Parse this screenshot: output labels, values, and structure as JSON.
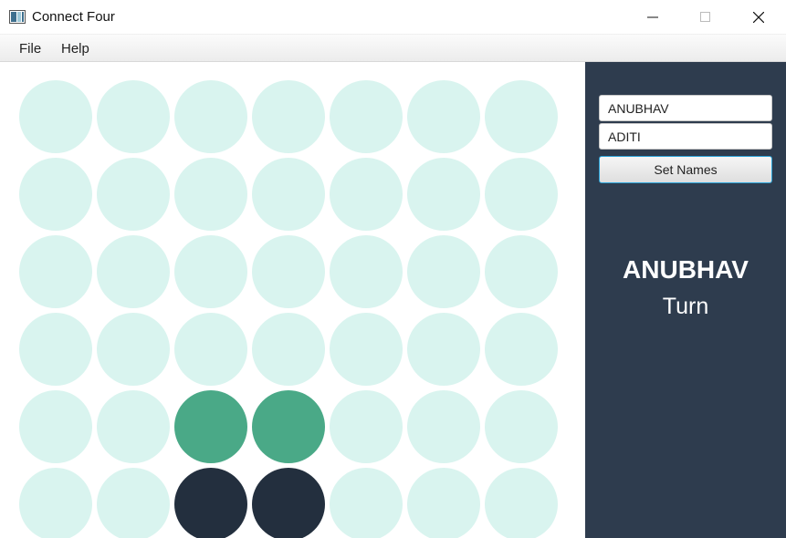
{
  "window": {
    "title": "Connect Four",
    "icon": "app-window-icon"
  },
  "menu": {
    "items": [
      "File",
      "Help"
    ]
  },
  "players": {
    "player_one_name": "ANUBHAV",
    "player_two_name": "ADITI",
    "set_names_label": "Set Names"
  },
  "status": {
    "current_player": "ANUBHAV",
    "turn_label": "Turn"
  },
  "colors": {
    "empty": "#d9f4ef",
    "player_one_disc": "#4aa987",
    "player_two_disc": "#232f3e",
    "panel": "#2e3c4e"
  },
  "board": {
    "columns": 7,
    "visible_rows": 6,
    "cells": [
      [
        "empty",
        "empty",
        "empty",
        "empty",
        "empty",
        "empty",
        "empty"
      ],
      [
        "empty",
        "empty",
        "empty",
        "empty",
        "empty",
        "empty",
        "empty"
      ],
      [
        "empty",
        "empty",
        "empty",
        "empty",
        "empty",
        "empty",
        "empty"
      ],
      [
        "empty",
        "empty",
        "empty",
        "empty",
        "empty",
        "empty",
        "empty"
      ],
      [
        "empty",
        "empty",
        "player_one",
        "player_one",
        "empty",
        "empty",
        "empty"
      ],
      [
        "empty",
        "empty",
        "player_two",
        "player_two",
        "empty",
        "empty",
        "empty"
      ]
    ]
  }
}
